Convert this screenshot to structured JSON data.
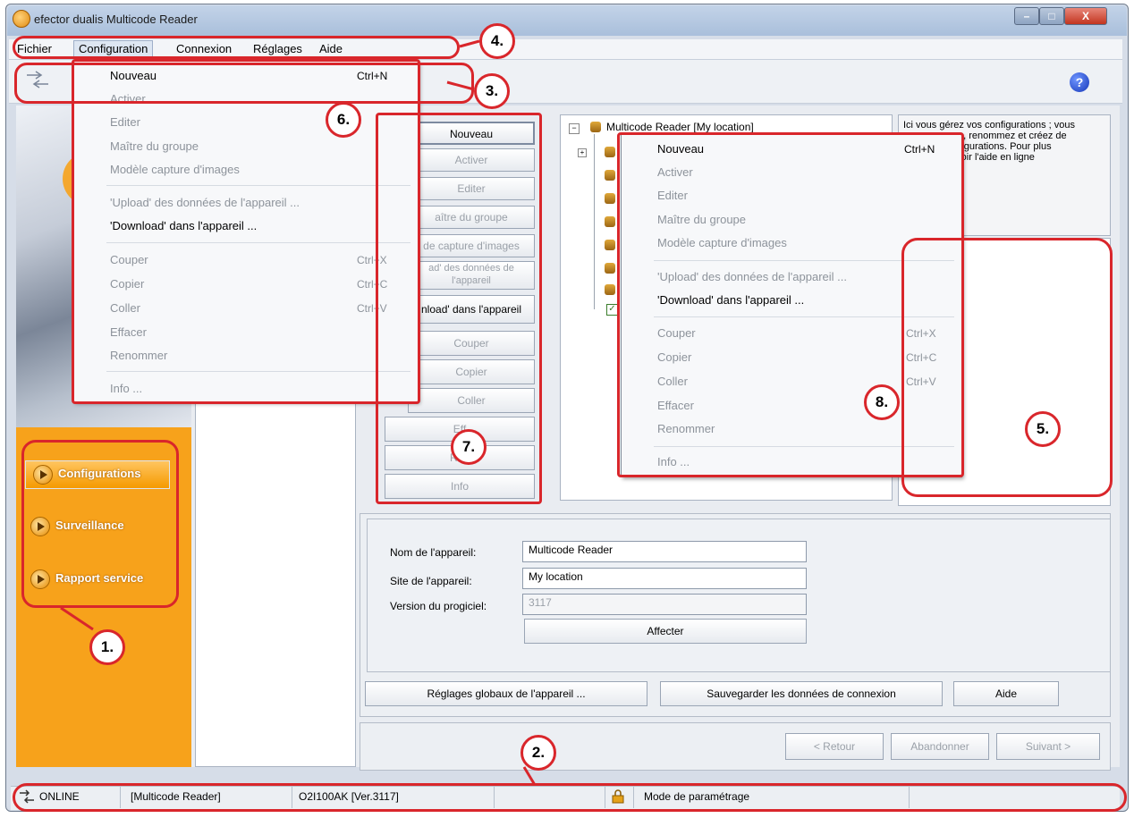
{
  "window": {
    "title": "efector dualis Multicode Reader"
  },
  "menubar": {
    "items": [
      "Fichier",
      "Configuration",
      "Connexion",
      "Réglages",
      "Aide"
    ]
  },
  "config_menu": {
    "items": [
      {
        "label": "Nouveau",
        "shortcut": "Ctrl+N"
      },
      {
        "label": "Activer"
      },
      {
        "label": "Editer"
      },
      {
        "label": "Maître du groupe"
      },
      {
        "label": "Modèle capture d'images"
      },
      {
        "label": "'Upload' des données de l'appareil ..."
      },
      {
        "label": "'Download' dans l'appareil ..."
      },
      {
        "label": "Couper",
        "shortcut": "Ctrl+X"
      },
      {
        "label": "Copier",
        "shortcut": "Ctrl+C"
      },
      {
        "label": "Coller",
        "shortcut": "Ctrl+V"
      },
      {
        "label": "Effacer"
      },
      {
        "label": "Renommer"
      },
      {
        "label": "Info ..."
      }
    ]
  },
  "context_menu": {
    "items": [
      {
        "label": "Nouveau",
        "shortcut": "Ctrl+N"
      },
      {
        "label": "Activer"
      },
      {
        "label": "Editer"
      },
      {
        "label": "Maître du groupe"
      },
      {
        "label": "Modèle capture d'images"
      },
      {
        "label": "'Upload' des données de l'appareil ..."
      },
      {
        "label": "'Download' dans l'appareil ..."
      },
      {
        "label": "Couper",
        "shortcut": "Ctrl+X"
      },
      {
        "label": "Copier",
        "shortcut": "Ctrl+C"
      },
      {
        "label": "Coller",
        "shortcut": "Ctrl+V"
      },
      {
        "label": "Effacer"
      },
      {
        "label": "Renommer"
      },
      {
        "label": "Info ..."
      }
    ]
  },
  "button_column": {
    "buttons": [
      "Nouveau",
      "Activer",
      "Editer",
      "aître du groupe",
      "de capture d'images",
      "ad' des données de",
      "l'appareil",
      "nload' dans l'appareil",
      "Couper",
      "Copier",
      "Coller",
      "Eff",
      "Ren",
      "Info"
    ]
  },
  "tree": {
    "root": "Multicode Reader [My location]"
  },
  "info_box": {
    "lines": [
      "Ici vous gérez vos configurations ; vous",
      "cez, renommez et créez de",
      "onfigurations. Pour plus",
      "e voir l'aide en ligne"
    ]
  },
  "sidebar": {
    "items": [
      "Configurations",
      "Surveillance",
      "Rapport service"
    ]
  },
  "device_form": {
    "name_label": "Nom de l'appareil:",
    "name_value": "Multicode Reader",
    "site_label": "Site de l'appareil:",
    "site_value": "My location",
    "version_label": "Version du progiciel:",
    "version_value": "3117",
    "assign_button": "Affecter"
  },
  "bottom_buttons": {
    "global": "Réglages globaux de l'appareil ...",
    "save": "Sauvegarder les données de connexion",
    "help": "Aide"
  },
  "wizard_buttons": {
    "back": "< Retour",
    "abort": "Abandonner",
    "next": "Suivant >"
  },
  "statusbar": {
    "online": "ONLINE",
    "device": "[Multicode Reader]",
    "firmware": "O2I100AK  [Ver.3117]",
    "mode": "Mode de paramétrage"
  },
  "annotations": [
    "1.",
    "2.",
    "3.",
    "4.",
    "5.",
    "6.",
    "7.",
    "8."
  ],
  "colors": {
    "highlight": "#d9262b",
    "sidebar": "#f7a21b"
  }
}
